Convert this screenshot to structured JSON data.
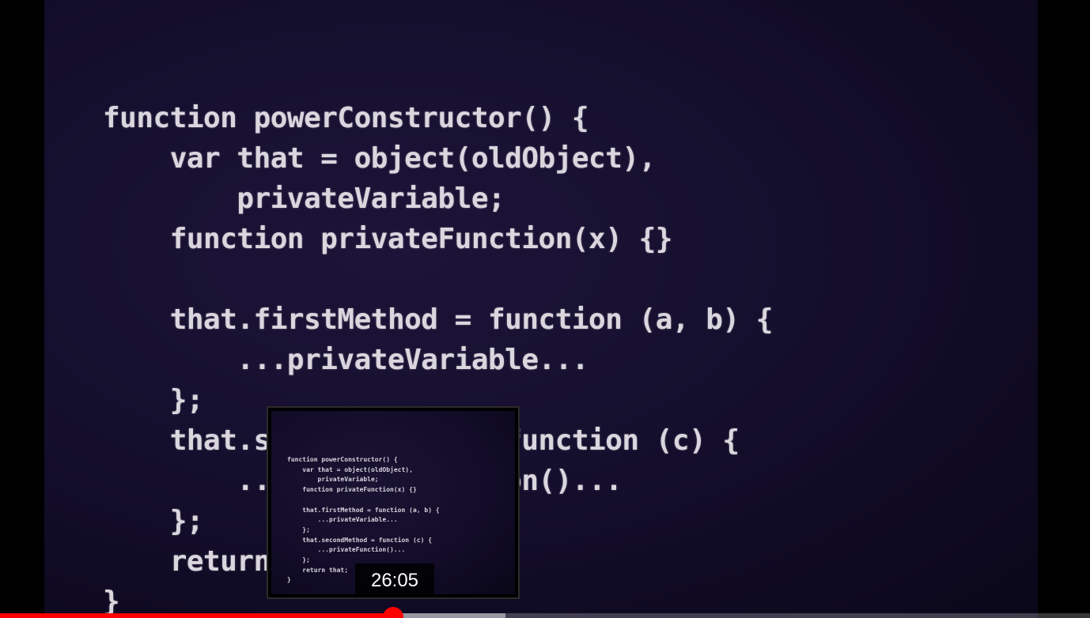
{
  "slide": {
    "code_lines": [
      "function powerConstructor() {",
      "    var that = object(oldObject),",
      "        privateVariable;",
      "    function privateFunction(x) {}",
      "",
      "    that.firstMethod = function (a, b) {",
      "        ...privateVariable...",
      "    };",
      "    that.secondMethod = function (c) {",
      "        ...privateFunction()...",
      "    };",
      "    return that;",
      "}"
    ]
  },
  "preview": {
    "time": "26:05",
    "code_lines": [
      "function powerConstructor() {",
      "    var that = object(oldObject),",
      "        privateVariable;",
      "    function privateFunction(x) {}",
      "",
      "    that.firstMethod = function (a, b) {",
      "        ...privateVariable...",
      "    };",
      "    that.secondMethod = function (c) {",
      "        ...privateFunction()...",
      "    };",
      "    return that;",
      "}"
    ]
  },
  "progress": {
    "played_fraction": 0.361,
    "buffered_fraction": 0.464,
    "color_played": "#ff0000"
  }
}
